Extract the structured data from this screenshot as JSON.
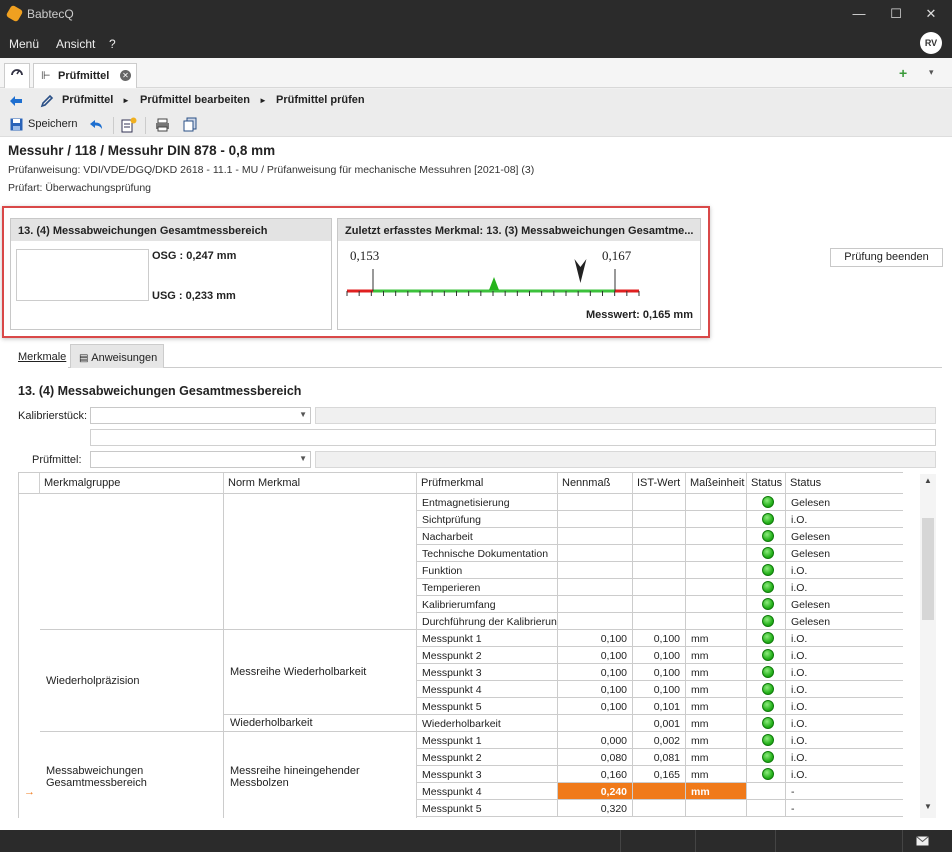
{
  "window": {
    "title": "BabtecQ",
    "minimize": "—",
    "maximize": "☐",
    "close": "✕"
  },
  "menu": {
    "items": [
      "Menü",
      "Ansicht",
      "?"
    ],
    "user_initials": "RV"
  },
  "tabs": {
    "doc_tab_label": "Prüfmittel",
    "add": "+",
    "dropdown": "▾"
  },
  "breadcrumb": {
    "items": [
      "Prüfmittel",
      "Prüfmittel bearbeiten",
      "Prüfmittel prüfen"
    ]
  },
  "toolbar": {
    "save_label": "Speichern"
  },
  "header": {
    "title": "Messuhr / 118 / Messuhr DIN 878 - 0,8 mm",
    "instruction": "Prüfanweisung: VDI/VDE/DGQ/DKD 2618 - 11.1 - MU / Prüfanweisung für mechanische Messuhren [2021-08] (3)",
    "test_type": "Prüfart: Überwachungsprüfung"
  },
  "panel_left": {
    "title": "13. (4) Messabweichungen Gesamtmessbereich",
    "osg": "OSG : 0,247 mm",
    "usg": "USG : 0,233 mm"
  },
  "panel_right": {
    "title": "Zuletzt erfasstes Merkmal: 13. (3) Messabweichungen Gesamtme...",
    "scale_low": "0,153",
    "scale_high": "0,167",
    "measured": "Messwert: 0,165 mm",
    "scale": {
      "min": 0.153,
      "max": 0.167,
      "nominal": 0.16,
      "value": 0.165
    }
  },
  "finish_button": "Prüfung beenden",
  "subtabs": [
    "Merkmale",
    "Anweisungen"
  ],
  "section_title": "13. (4) Messabweichungen Gesamtmessbereich",
  "form": {
    "kalibrier_label": "Kalibrierstück:",
    "pruefmittel_label": "Prüfmittel:"
  },
  "grid": {
    "headers": [
      "Merkmalgruppe",
      "Norm Merkmal",
      "Prüfmerkmal",
      "Nennmaß",
      "IST-Wert",
      "Maßeinheit",
      "Status",
      "Status"
    ],
    "groups": [
      {
        "merkmalgruppe": "",
        "norm_merkmal": ""
      },
      {
        "merkmalgruppe": "Wiederholpräzision",
        "norm_merkmal": "Messreihe Wiederholbarkeit"
      },
      {
        "norm_merkmal": "Wiederholbarkeit"
      },
      {
        "merkmalgruppe": "Messabweichungen Gesamtmessbereich",
        "norm_merkmal": "Messreihe hineingehender Messbolzen"
      }
    ],
    "current_row_marker": "→",
    "rows": [
      {
        "pruefmerkmal": "Entmagnetisierung",
        "nennmass": "",
        "ist": "",
        "einheit": "",
        "status_ok": true,
        "status": "Gelesen"
      },
      {
        "pruefmerkmal": "Sichtprüfung",
        "nennmass": "",
        "ist": "",
        "einheit": "",
        "status_ok": true,
        "status": "i.O."
      },
      {
        "pruefmerkmal": "Nacharbeit",
        "nennmass": "",
        "ist": "",
        "einheit": "",
        "status_ok": true,
        "status": "Gelesen"
      },
      {
        "pruefmerkmal": "Technische Dokumentation",
        "nennmass": "",
        "ist": "",
        "einheit": "",
        "status_ok": true,
        "status": "Gelesen"
      },
      {
        "pruefmerkmal": "Funktion",
        "nennmass": "",
        "ist": "",
        "einheit": "",
        "status_ok": true,
        "status": "i.O."
      },
      {
        "pruefmerkmal": "Temperieren",
        "nennmass": "",
        "ist": "",
        "einheit": "",
        "status_ok": true,
        "status": "i.O."
      },
      {
        "pruefmerkmal": "Kalibrierumfang",
        "nennmass": "",
        "ist": "",
        "einheit": "",
        "status_ok": true,
        "status": "Gelesen"
      },
      {
        "pruefmerkmal": "Durchführung der Kalibrierung",
        "nennmass": "",
        "ist": "",
        "einheit": "",
        "status_ok": true,
        "status": "Gelesen"
      },
      {
        "pruefmerkmal": "Messpunkt 1",
        "nennmass": "0,100",
        "ist": "0,100",
        "einheit": "mm",
        "status_ok": true,
        "status": "i.O."
      },
      {
        "pruefmerkmal": "Messpunkt 2",
        "nennmass": "0,100",
        "ist": "0,100",
        "einheit": "mm",
        "status_ok": true,
        "status": "i.O."
      },
      {
        "pruefmerkmal": "Messpunkt 3",
        "nennmass": "0,100",
        "ist": "0,100",
        "einheit": "mm",
        "status_ok": true,
        "status": "i.O."
      },
      {
        "pruefmerkmal": "Messpunkt 4",
        "nennmass": "0,100",
        "ist": "0,100",
        "einheit": "mm",
        "status_ok": true,
        "status": "i.O."
      },
      {
        "pruefmerkmal": "Messpunkt 5",
        "nennmass": "0,100",
        "ist": "0,101",
        "einheit": "mm",
        "status_ok": true,
        "status": "i.O."
      },
      {
        "pruefmerkmal": "Wiederholbarkeit",
        "nennmass": "",
        "ist": "0,001",
        "einheit": "mm",
        "status_ok": true,
        "status": "i.O."
      },
      {
        "pruefmerkmal": "Messpunkt 1",
        "nennmass": "0,000",
        "ist": "0,002",
        "einheit": "mm",
        "status_ok": true,
        "status": "i.O."
      },
      {
        "pruefmerkmal": "Messpunkt 2",
        "nennmass": "0,080",
        "ist": "0,081",
        "einheit": "mm",
        "status_ok": true,
        "status": "i.O."
      },
      {
        "pruefmerkmal": "Messpunkt 3",
        "nennmass": "0,160",
        "ist": "0,165",
        "einheit": "mm",
        "status_ok": true,
        "status": "i.O."
      },
      {
        "pruefmerkmal": "Messpunkt 4",
        "nennmass": "0,240",
        "ist": "",
        "einheit": "mm",
        "status_ok": false,
        "status": "-",
        "active": true
      },
      {
        "pruefmerkmal": "Messpunkt 5",
        "nennmass": "0,320",
        "ist": "",
        "einheit": "",
        "status_ok": false,
        "status": "-"
      }
    ]
  },
  "colors": {
    "accent_active": "#f07a1a",
    "ok_green": "#27b31d",
    "frame_red": "#d94848"
  }
}
